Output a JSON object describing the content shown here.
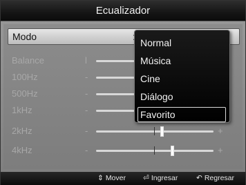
{
  "header": {
    "title": "Ecualizador"
  },
  "mode": {
    "label": "Modo",
    "separator": ":"
  },
  "rows": [
    {
      "name": "Balance",
      "minus": "l",
      "plus": "",
      "level": null
    },
    {
      "name": "100Hz",
      "minus": "-",
      "plus": "",
      "level": null
    },
    {
      "name": "500Hz",
      "minus": "-",
      "plus": "",
      "level": null
    },
    {
      "name": "1kHz",
      "minus": "-",
      "plus": "",
      "level": null
    },
    {
      "name": "2kHz",
      "minus": "-",
      "plus": "+",
      "level": 0.56
    },
    {
      "name": "4kHz",
      "minus": "-",
      "plus": "+",
      "level": 0.65
    }
  ],
  "dropdown": {
    "options": [
      "Normal",
      "Música",
      "Cine",
      "Diálogo",
      "Favorito"
    ],
    "selected_index": 4
  },
  "footer": {
    "move": {
      "icon": "up-down-arrow-icon",
      "glyph": "⇕",
      "label": "Mover"
    },
    "enter": {
      "icon": "enter-icon",
      "glyph": "⏎",
      "label": "Ingresar"
    },
    "back": {
      "icon": "return-icon",
      "glyph": "↶",
      "label": "Regresar"
    }
  },
  "colors": {
    "background": "#8a8a8a",
    "bar": "#111111",
    "text_dim": "#a8a8a8"
  }
}
